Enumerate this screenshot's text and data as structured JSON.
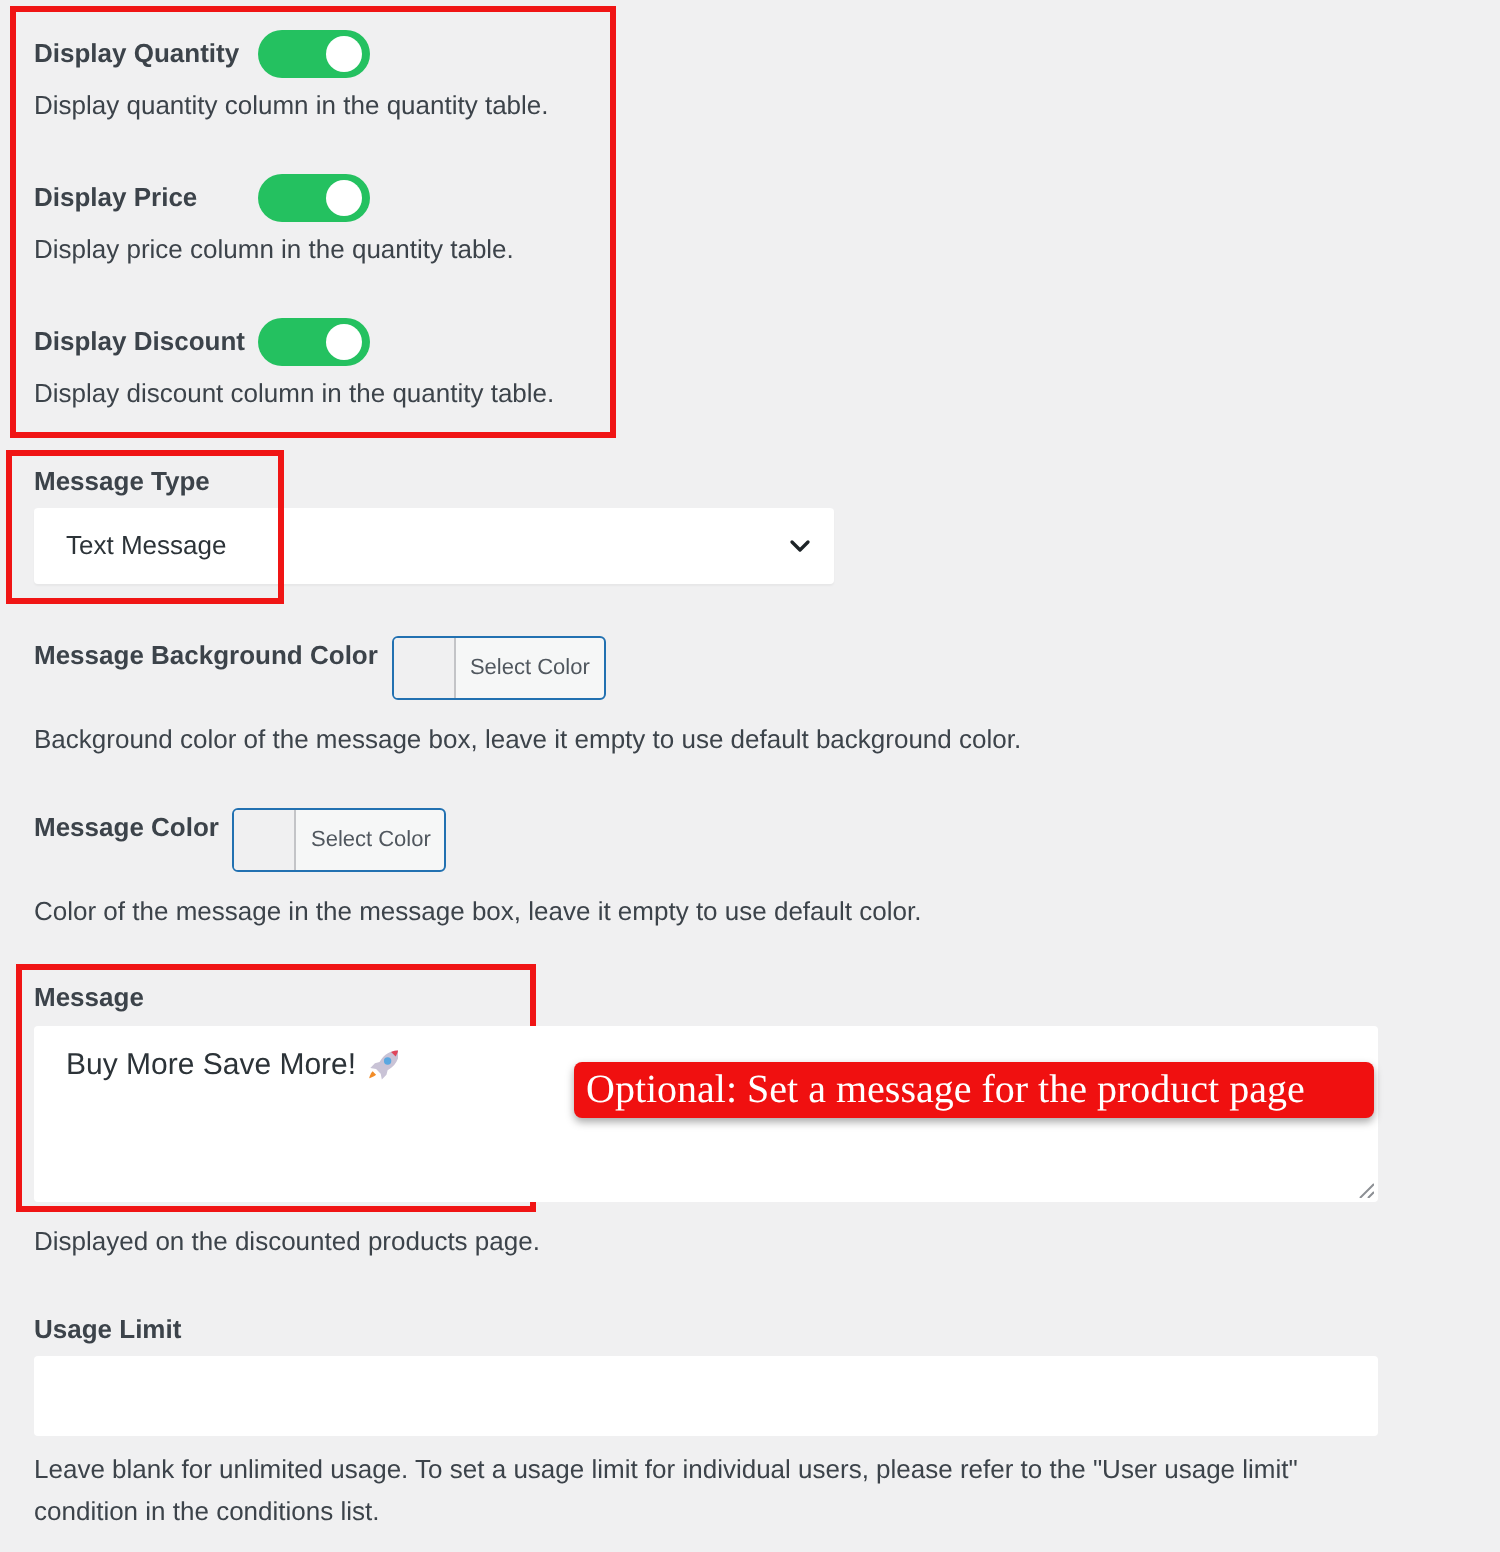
{
  "toggles": {
    "highlighted": true,
    "items": [
      {
        "label": "Display Quantity",
        "on": true,
        "description": "Display quantity column in the quantity table."
      },
      {
        "label": "Display Price",
        "on": true,
        "description": "Display price column in the quantity table."
      },
      {
        "label": "Display Discount",
        "on": true,
        "description": "Display discount column in the quantity table."
      }
    ]
  },
  "message_type": {
    "label": "Message Type",
    "value": "Text Message",
    "highlighted": true
  },
  "color_fields": [
    {
      "label": "Message Background Color",
      "button": "Select Color",
      "description": "Background color of the message box, leave it empty to use default background color."
    },
    {
      "label": "Message Color",
      "button": "Select Color",
      "description": "Color of the message in the message box, leave it empty to use default color."
    }
  ],
  "message": {
    "label": "Message",
    "value": "Buy More Save More!",
    "highlighted": true,
    "annotation": "Optional: Set a message for the product page",
    "description": "Displayed on the discounted products page."
  },
  "usage_limit": {
    "label": "Usage Limit",
    "description": "Leave blank for unlimited usage. To set a usage limit for individual users, please refer to the \"User usage limit\" condition in the conditions list."
  }
}
